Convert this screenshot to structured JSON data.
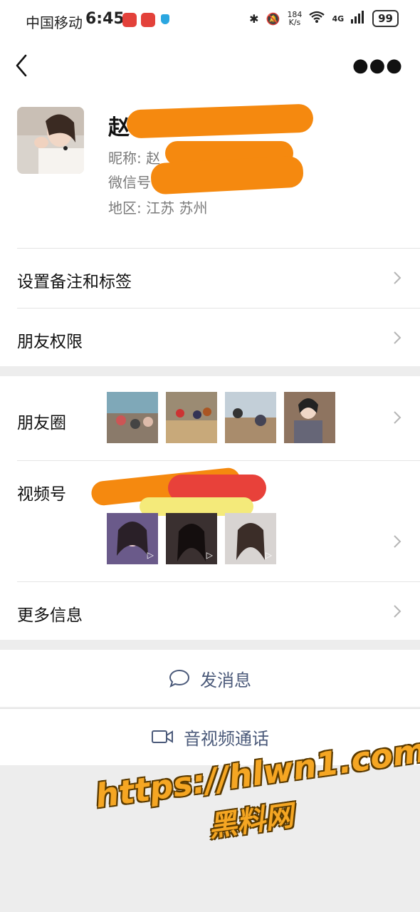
{
  "status": {
    "carrier": "中国移动",
    "time": "6:45",
    "net_speed_value": "184",
    "net_speed_unit": "K/s",
    "network": "4G",
    "battery": "99"
  },
  "profile": {
    "name": "赵",
    "nickname_label": "昵称:",
    "nickname_value": "赵",
    "wechat_id_label": "微信号",
    "region_label": "地区:",
    "region_value": "江苏  苏州"
  },
  "menu": {
    "remark_tags": "设置备注和标签",
    "friend_permissions": "朋友权限",
    "moments": "朋友圈",
    "channels": "视频号",
    "more_info": "更多信息"
  },
  "actions": {
    "send_message": "发消息",
    "av_call": "音视频通话"
  },
  "watermark": {
    "url": "https://hlwn1.com",
    "site": "黑料网"
  },
  "colors": {
    "redaction_orange": "#f5890f",
    "redaction_red": "#e8413a",
    "redaction_yellow": "#f4ea7a",
    "action_text": "#4b5a7a"
  }
}
